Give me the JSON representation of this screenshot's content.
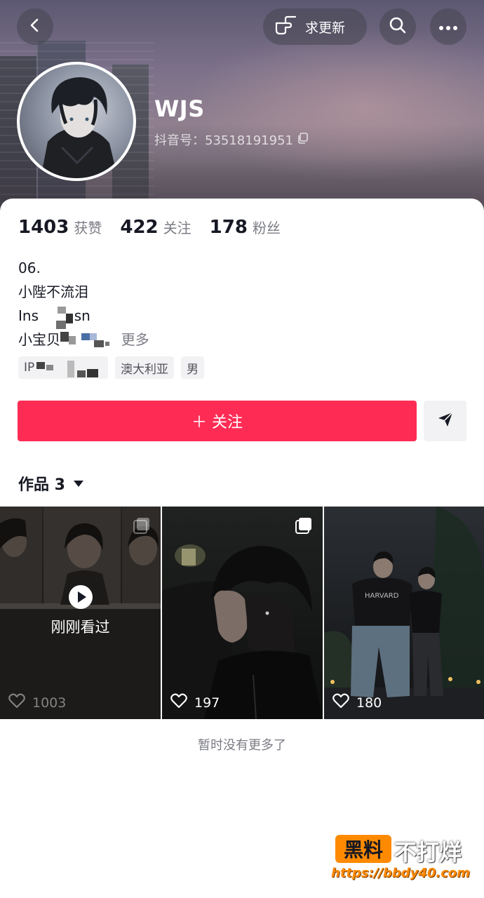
{
  "header": {
    "update_label": "求更新",
    "username": "WJS",
    "douyin_id": "抖音号：53518191951"
  },
  "stats": [
    {
      "value": "1403",
      "label": "获赞"
    },
    {
      "value": "422",
      "label": "关注"
    },
    {
      "value": "178",
      "label": "粉丝"
    }
  ],
  "bio": {
    "line1": "06.",
    "line2": "小陛不流泪",
    "line3_visible": "Ins",
    "line3_tail": "sn",
    "line4_visible": "小宝贝",
    "more_label": "更多"
  },
  "tags": {
    "ip_prefix": "IP",
    "location": "澳大利亚",
    "gender": "男"
  },
  "actions": {
    "follow_label": "＋ 关注"
  },
  "works": {
    "tab_label": "作品 3",
    "items": [
      {
        "likes": "1003",
        "overlay": "刚刚看过"
      },
      {
        "likes": "197"
      },
      {
        "likes": "180"
      }
    ],
    "end_text": "暂时没有更多了"
  },
  "watermark": {
    "badge": "黑料",
    "text": "不打烊",
    "url": "https://bbdy40.com"
  },
  "colors": {
    "follow_button": "#fe2c55",
    "watermark_orange": "#ff8a00"
  }
}
